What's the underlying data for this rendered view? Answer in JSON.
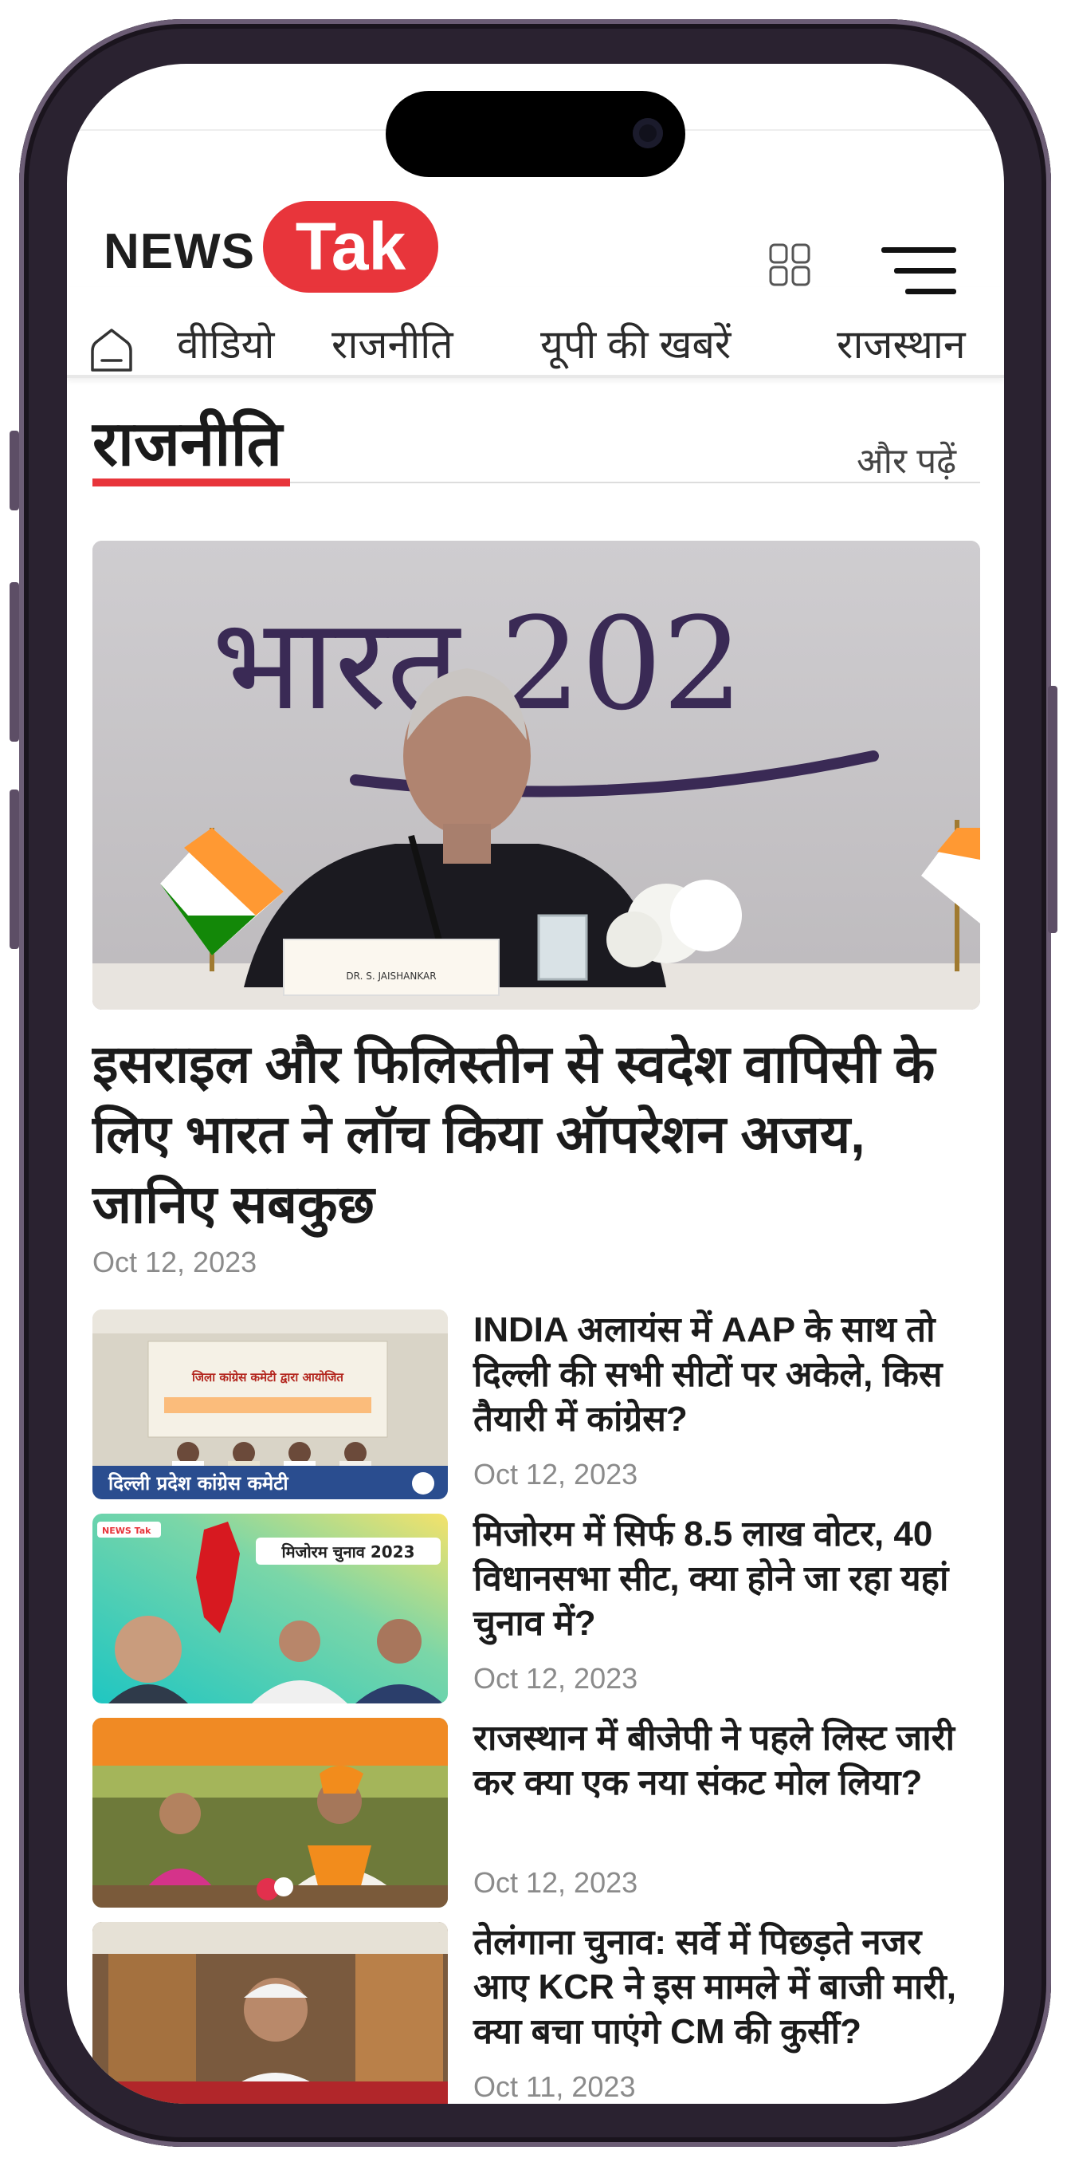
{
  "header": {
    "logo_news": "NEWS",
    "logo_tak": "Tak"
  },
  "nav": {
    "items": [
      {
        "label": "वीडियो"
      },
      {
        "label": "राजनीति"
      },
      {
        "label": "यूपी की खबरें"
      },
      {
        "label": "राजस्थान"
      }
    ]
  },
  "section": {
    "title": "राजनीति",
    "more_label": "और पढ़ें"
  },
  "hero": {
    "image_backdrop_text": "भारत 202",
    "nameplate_text": "DR. S. JAISHANKAR",
    "title": "इसराइल और फिलिस्तीन से स्वदेश वापिसी के लिए भारत ने लॉच किया ऑपरेशन अजय, जानिए सबकुछ",
    "date": "Oct 12, 2023"
  },
  "stories": [
    {
      "title": "INDIA अलायंस में AAP के साथ तो दिल्ली की सभी सीटों पर अकेले, किस तैयारी में कांग्रेस?",
      "date": "Oct 12, 2023",
      "thumb_caption": "दिल्ली प्रदेश कांग्रेस कमेटी",
      "thumb_banner": "जिला कांग्रेस कमेटी द्वारा आयोजित"
    },
    {
      "title": "मिजोरम में सिर्फ 8.5 लाख वोटर, 40 विधानसभा सीट, क्या होने जा रहा यहां चुनाव में?",
      "date": "Oct 12, 2023",
      "thumb_caption": "मिजोरम चुनाव 2023",
      "thumb_brand": "NEWS Tak"
    },
    {
      "title": "राजस्थान में बीजेपी ने पहले लिस्ट जारी कर क्या एक नया संकट मोल लिया?",
      "date": "Oct 12, 2023"
    },
    {
      "title": "तेलंगाना चुनाव: सर्वे में पिछड़ते नजर आए KCR ने इस मामले में बाजी मारी, क्या बचा पाएंगे CM की कुर्सी?",
      "date": "Oct 11, 2023"
    }
  ],
  "colors": {
    "brand_red": "#e8353b",
    "text_dark": "#1b1b1b",
    "date_gray": "#8b8b8b"
  },
  "icons": [
    "home-icon",
    "grid-icon",
    "hamburger-menu-icon"
  ]
}
